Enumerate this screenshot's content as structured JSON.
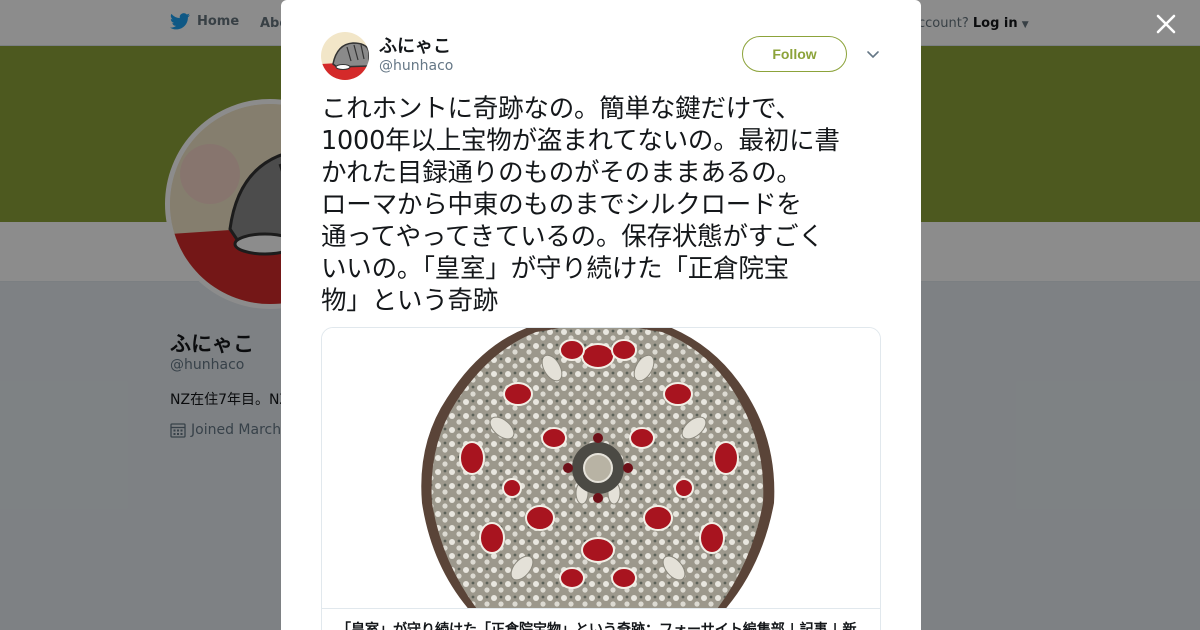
{
  "background_page": {
    "nav": {
      "home_label": "Home",
      "about_label": "Abo",
      "account_prompt": "ccount?",
      "login_label": "Log in"
    },
    "profile": {
      "name": "ふにゃこ",
      "handle": "@hunhaco",
      "bio": "NZ在住7年目。NZ",
      "joined": "Joined March"
    },
    "banner_color": "#8ca33a"
  },
  "modal": {
    "author": {
      "name": "ふにゃこ",
      "handle": "@hunhaco"
    },
    "follow_label": "Follow",
    "tweet_text": "これホントに奇跡なの。簡単な鍵だけで、\n1000年以上宝物が盗まれてないの。最初に書\nかれた目録通りのものがそのままあるの。\nローマから中東のものまでシルクロードを\n通ってやってきているの。保存状態がすごく\nいいの。「皇室」が守り続けた「正倉院宝\n物」という奇跡",
    "card": {
      "image_icon": "ornate-mirror-image",
      "title": "「皇室」が守り続けた「正倉院宝物」という奇跡：フォーサイト編集部 | 記事 | 新"
    }
  },
  "icons": {
    "close": "close-icon",
    "caret": "chevron-down-icon",
    "bird": "twitter-bird-icon",
    "calendar": "calendar-icon"
  },
  "colors": {
    "accent": "#8ca33a",
    "text": "#14171a",
    "secondary": "#657786"
  }
}
